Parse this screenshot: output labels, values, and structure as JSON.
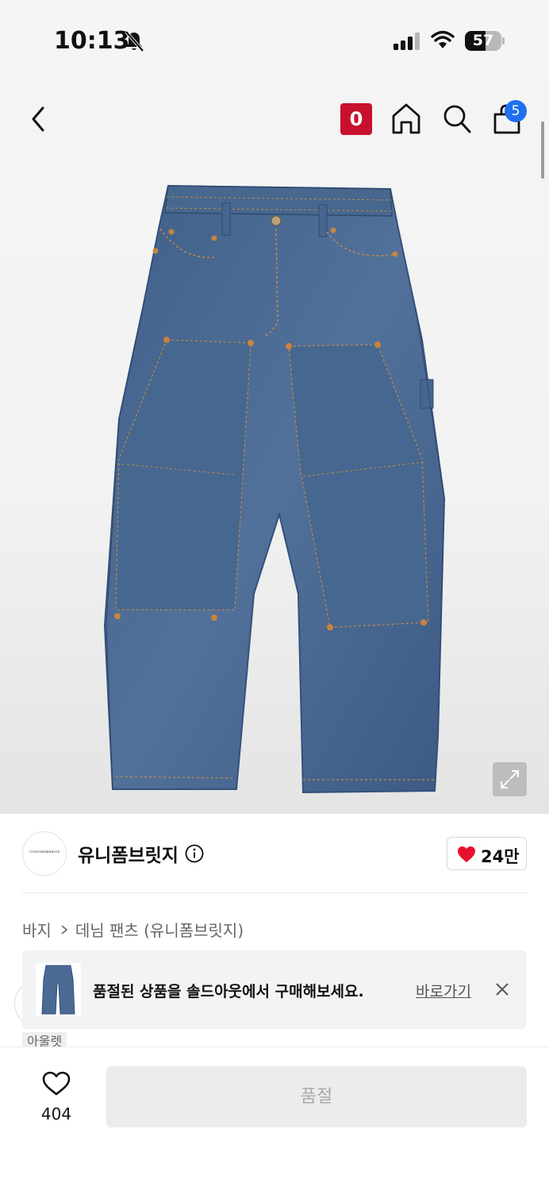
{
  "status_bar": {
    "time": "10:13",
    "battery": "57"
  },
  "nav": {
    "shop_badge": "0",
    "cart_count": "5"
  },
  "brand": {
    "name": "유니폼브릿지",
    "logo_text": "UNIFORMBRIDGE",
    "likes": "24만"
  },
  "breadcrumb": {
    "category": "바지",
    "subcategory": "데님 팬츠 (유니폼브릿지)"
  },
  "banner": {
    "message": "품절된 상품을 솔드아웃에서 구매해보세요.",
    "link": "바로가기"
  },
  "outlet_tag": "아울렛",
  "bottom_bar": {
    "wish_count": "404",
    "buy_label": "품절"
  },
  "colors": {
    "accent_red": "#c8102e",
    "badge_blue": "#1f6ff0",
    "heart_red": "#e8112d",
    "denim": "#4a6a93"
  }
}
